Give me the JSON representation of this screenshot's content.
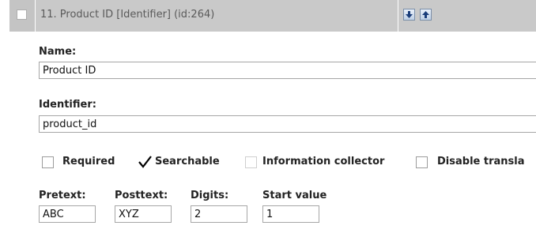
{
  "attribute": {
    "header_title": "11. Product ID [Identifier] (id:264)",
    "move_down_icon": "arrow-down-icon",
    "move_up_icon": "arrow-up-icon",
    "name_label": "Name:",
    "name_value": "Product ID",
    "identifier_label": "Identifier:",
    "identifier_value": "product_id",
    "options": {
      "required": {
        "label": "Required",
        "checked": false,
        "disabled": false
      },
      "searchable": {
        "label": "Searchable",
        "checked": true,
        "disabled": false
      },
      "information_collector": {
        "label": "Information collector",
        "checked": false,
        "disabled": true
      },
      "disable_translation": {
        "label": "Disable transla",
        "checked": false,
        "disabled": false
      }
    },
    "pretext_label": "Pretext:",
    "pretext_value": "ABC",
    "posttext_label": "Posttext:",
    "posttext_value": "XYZ",
    "digits_label": "Digits:",
    "digits_value": "2",
    "start_value_label": "Start value",
    "start_value_value": "1"
  },
  "colors": {
    "header_bg": "#c9c9c9",
    "checkmark": "#000000",
    "arrow_icon": "#1a3d7a"
  }
}
